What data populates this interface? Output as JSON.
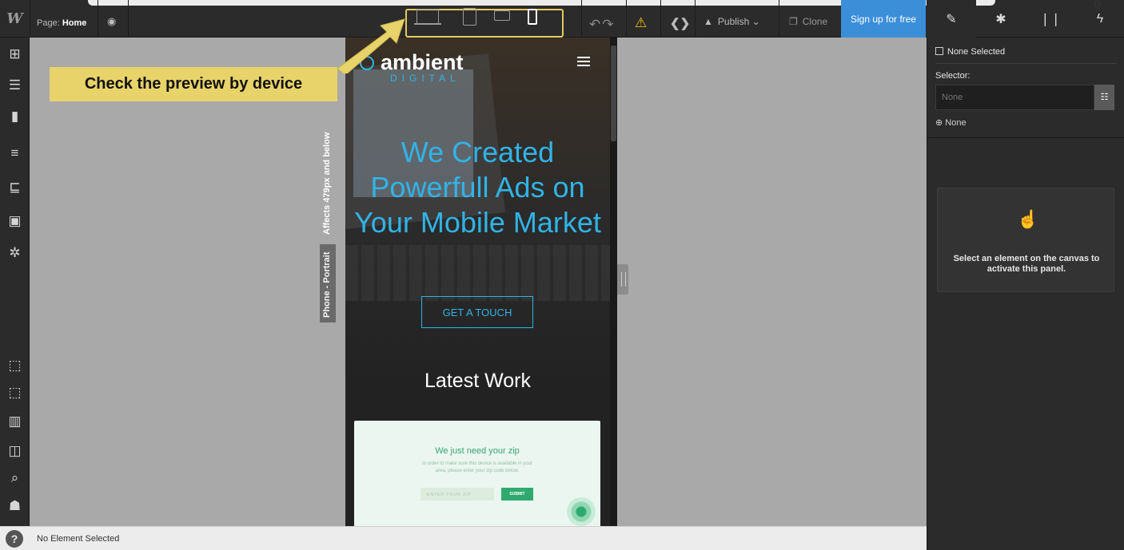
{
  "browser": {
    "user_icon": "user-icon",
    "user_glyph": "g"
  },
  "topbar": {
    "logo": "W",
    "page_prefix": "Page:",
    "page_name": "Home",
    "preview_icon": "eye-icon",
    "devices": [
      "desktop-icon",
      "tablet-icon",
      "phone-landscape-icon",
      "phone-portrait-icon"
    ],
    "active_device": "phone-portrait",
    "warning_icon": "warning-icon",
    "code_glyph": "❮❯",
    "publish_label": "Publish",
    "clone_label": "Clone",
    "signup_label": "Sign up for free",
    "accent_color": "#3b8fd9"
  },
  "right_tabs": [
    "brush-icon",
    "gear-icon",
    "drops-icon",
    "bolt-icon"
  ],
  "left_tools": {
    "top": [
      "add-icon",
      "navigator-icon",
      "pages-icon",
      "cms-icon",
      "ecommerce-icon",
      "assets-icon",
      "settings-icon"
    ],
    "bottom": [
      "select-icon",
      "preview-select-icon",
      "audit-icon",
      "layout-icon",
      "search-icon",
      "people-icon"
    ]
  },
  "canvas": {
    "affects_label": "Affects 479px and below",
    "breakpoint_label": "Phone - Portrait",
    "callout": "Check the preview by device"
  },
  "site": {
    "brand_name": "ambient",
    "brand_sub": "DIGITAL",
    "headline": "We Created Powerfull Ads on Your Mobile Market",
    "cta": "GET A TOUCH",
    "section_title": "Latest Work",
    "card_title": "We just need your zip",
    "card_text": "In order to make sure this device is available in your area, please enter your zip code below.",
    "zip_placeholder": "ENTER YOUR ZIP",
    "submit_label": "SUBMIT",
    "accent_color": "#31b3e6"
  },
  "right_panel": {
    "selection": "None Selected",
    "selector_label": "Selector:",
    "selector_placeholder": "None",
    "state_label": "None",
    "empty_message": "Select an element on the canvas to activate this panel."
  },
  "status": {
    "help": "?",
    "text": "No Element Selected"
  }
}
